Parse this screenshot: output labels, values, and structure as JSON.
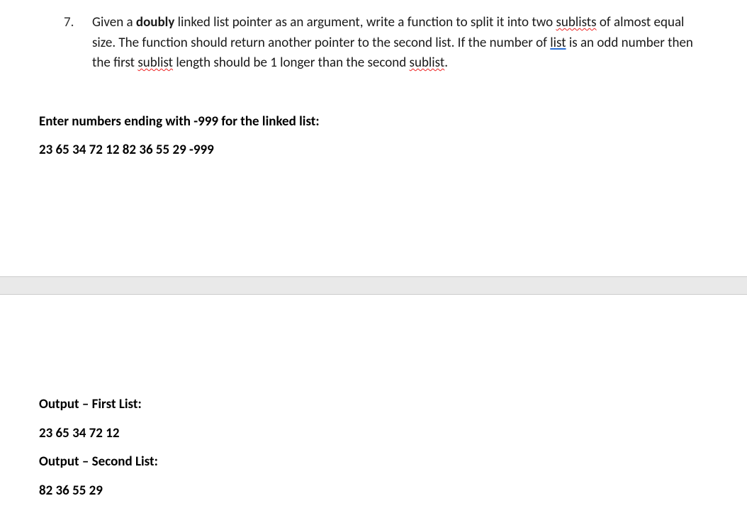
{
  "question": {
    "number": "7.",
    "part1": "Given a ",
    "bold1": "doubly",
    "part2": " linked list pointer as an argument, write a function to split it into two ",
    "spell1": "sublists",
    "part3": " of almost equal size. The function should return another pointer to the second list. If the number of ",
    "spell2": "list",
    "part4": " is an odd number then the first ",
    "spell3": "sublist",
    "part5": " length should be 1 longer than the second ",
    "spell4": "sublist",
    "part6": "."
  },
  "input": {
    "prompt": "Enter numbers ending with -999 for the linked list:",
    "values": "23 65 34 72 12 82 36 55 29 -999"
  },
  "output": {
    "label1": "Output – First List:",
    "list1": "23 65 34 72 12",
    "label2": "Output – Second List:",
    "list2": "82 36 55 29"
  }
}
